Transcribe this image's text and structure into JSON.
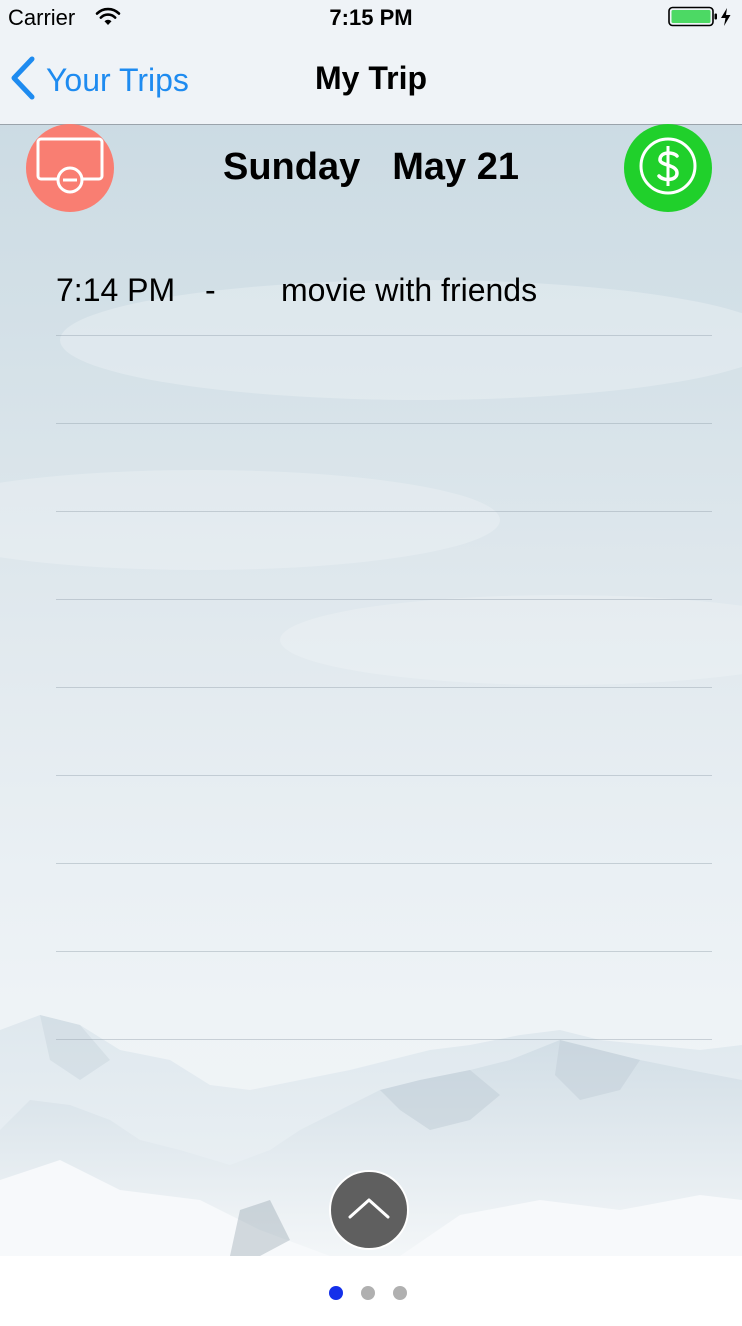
{
  "status_bar": {
    "carrier": "Carrier",
    "time": "7:15 PM",
    "wifi_icon": "wifi-icon",
    "battery_icon": "battery-charging-icon",
    "battery_color": "#4cd964"
  },
  "nav": {
    "back_label": "Your Trips",
    "back_icon": "chevron-left-icon",
    "title": "My Trip",
    "accent_color": "#1e8bf0"
  },
  "actions": {
    "remove_icon": "screen-remove-icon",
    "remove_color": "#f97e72",
    "money_icon": "dollar-icon",
    "money_color": "#20d02b"
  },
  "day": {
    "weekday": "Sunday",
    "date": "May 21"
  },
  "events": [
    {
      "time": "7:14 PM",
      "separator": "-",
      "title": "movie with friends"
    },
    {
      "time": "",
      "separator": "",
      "title": ""
    },
    {
      "time": "",
      "separator": "",
      "title": ""
    },
    {
      "time": "",
      "separator": "",
      "title": ""
    },
    {
      "time": "",
      "separator": "",
      "title": ""
    },
    {
      "time": "",
      "separator": "",
      "title": ""
    },
    {
      "time": "",
      "separator": "",
      "title": ""
    },
    {
      "time": "",
      "separator": "",
      "title": ""
    },
    {
      "time": "",
      "separator": "",
      "title": ""
    }
  ],
  "scroll_button": {
    "icon": "chevron-up-icon"
  },
  "page_control": {
    "page_count": 3,
    "current_page": 1,
    "active_color": "#1430ea"
  }
}
